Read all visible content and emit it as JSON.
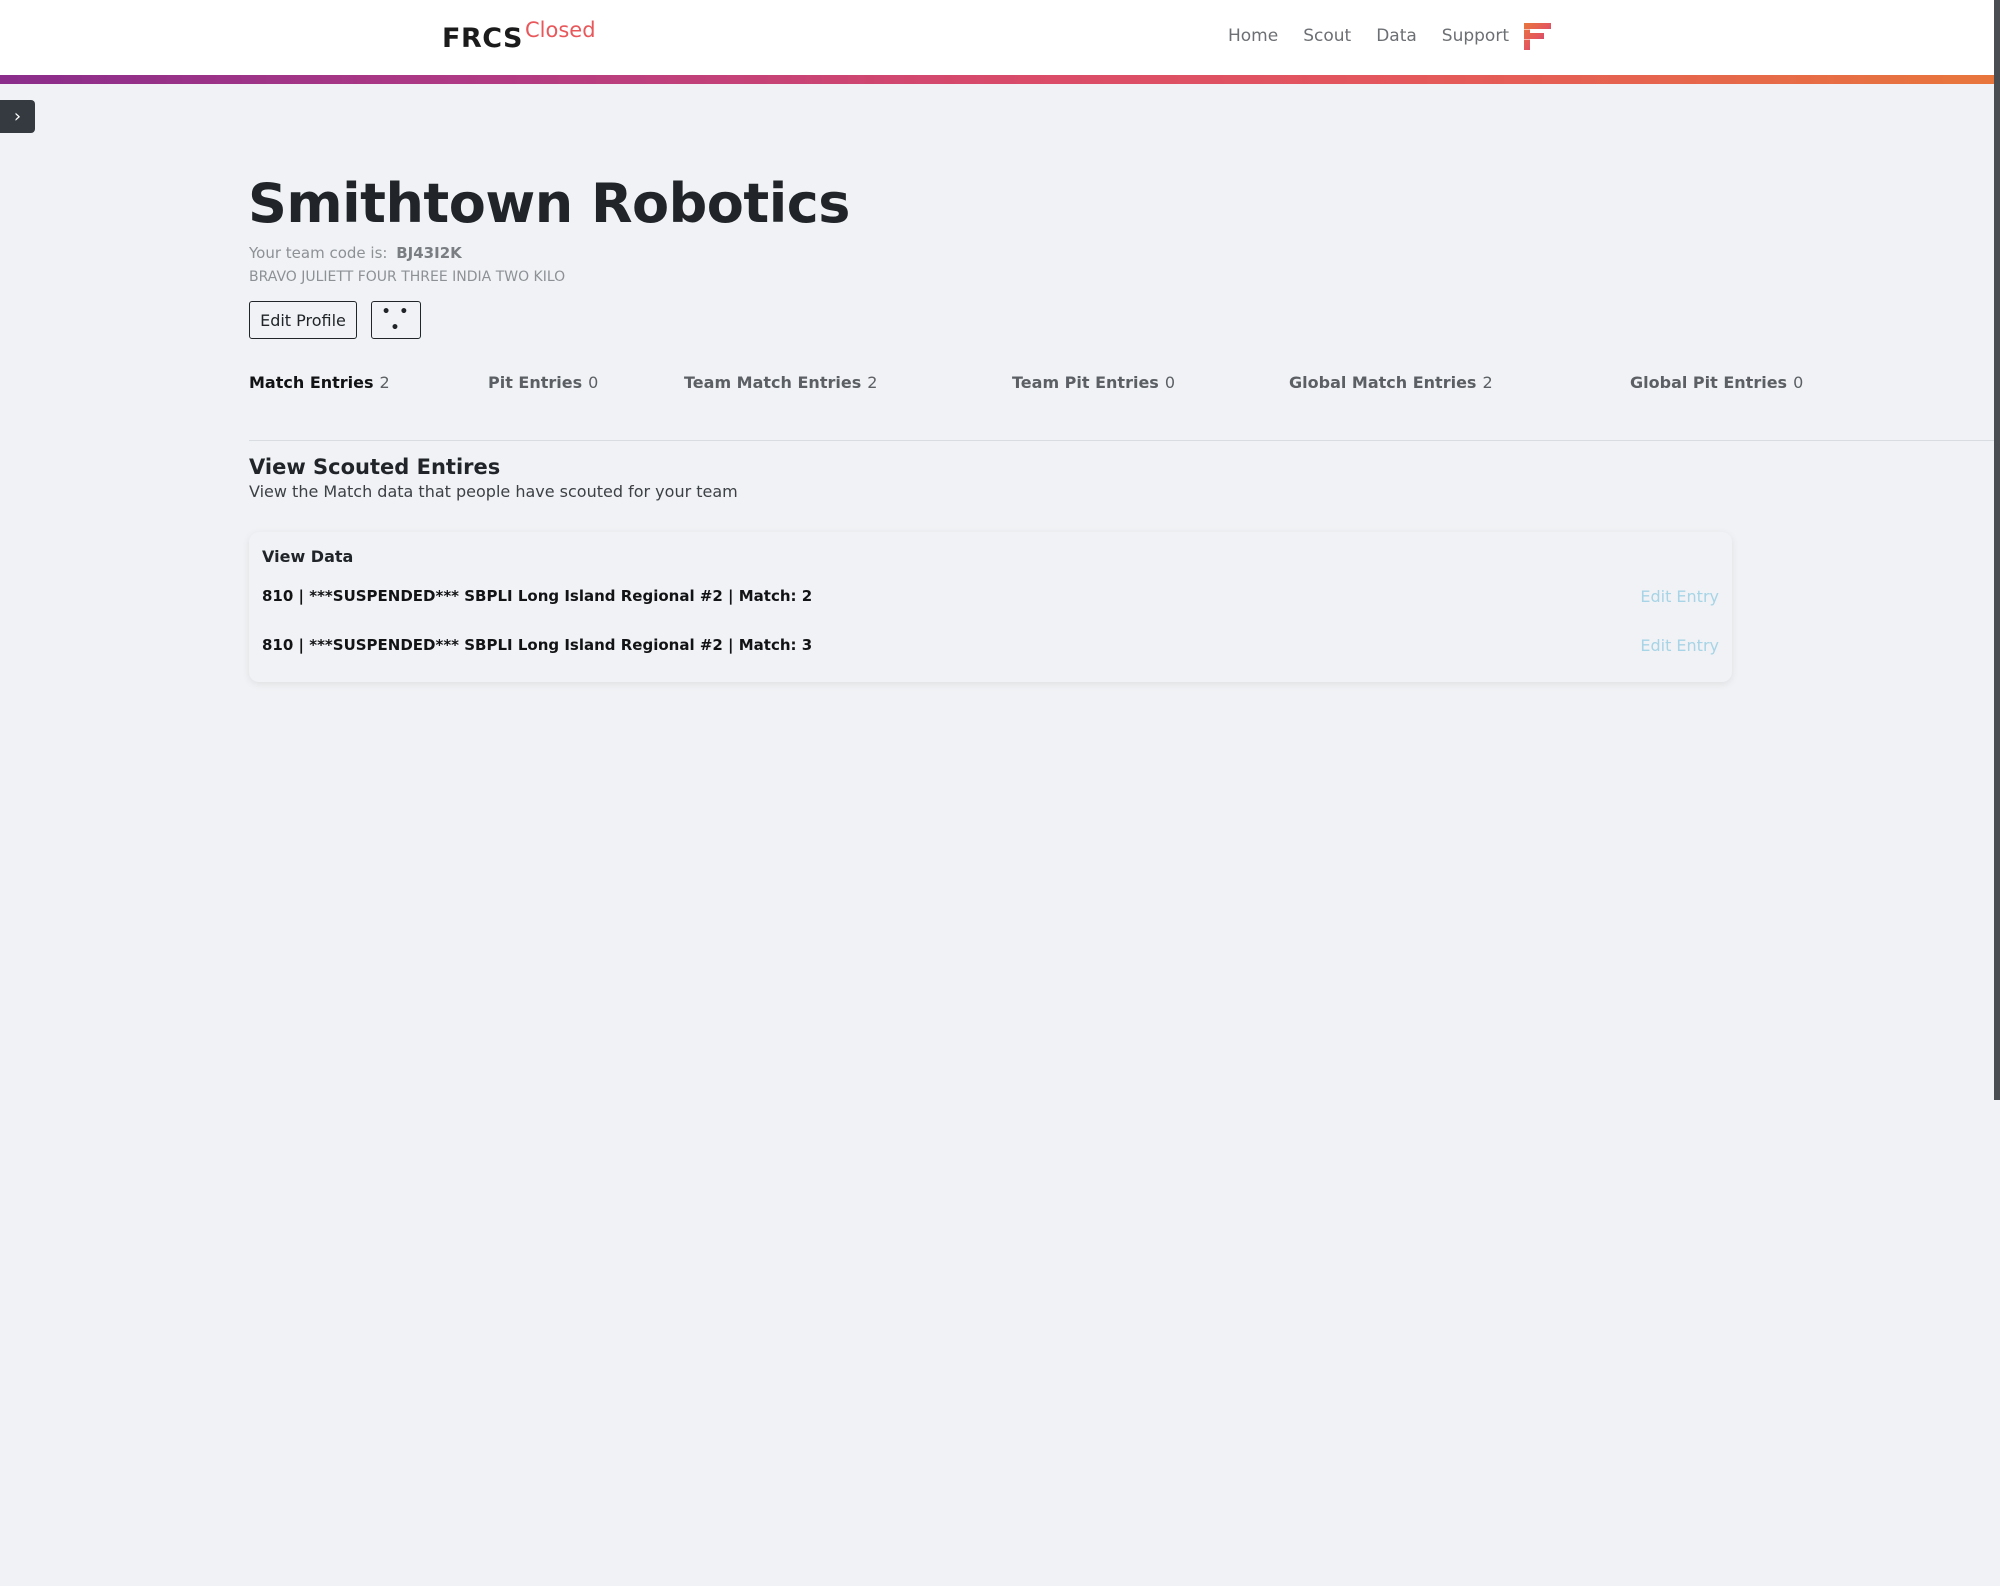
{
  "navbar": {
    "brand": "FRCS",
    "brand_sup": "Closed",
    "links": [
      "Home",
      "Scout",
      "Data",
      "Support"
    ],
    "logo_icon": "frcs-logo-icon"
  },
  "sidebar": {
    "toggle_icon": "chevron-right-icon",
    "toggle_glyph": "›"
  },
  "team": {
    "name": "Smithtown Robotics",
    "code_label": "Your team code is:",
    "code": "BJ43I2K",
    "phonetic": "BRAVO JULIETT FOUR THREE INDIA TWO KILO",
    "edit_profile_label": "Edit Profile",
    "more_label": "• • •"
  },
  "tabs": [
    {
      "label": "Match Entries",
      "count": "2",
      "active": true
    },
    {
      "label": "Pit Entries",
      "count": "0",
      "active": false
    },
    {
      "label": "Team Match Entries",
      "count": "2",
      "active": false
    },
    {
      "label": "Team Pit Entries",
      "count": "0",
      "active": false
    },
    {
      "label": "Global Match Entries",
      "count": "2",
      "active": false
    },
    {
      "label": "Global Pit Entries",
      "count": "0",
      "active": false
    }
  ],
  "section": {
    "title": "View Scouted Entires",
    "subtitle": "View the Match data that people have scouted for your team"
  },
  "card": {
    "header": "View Data",
    "entries": [
      {
        "text": "810 | ***SUSPENDED*** SBPLI Long Island Regional #2 | Match: 2",
        "action": "Edit Entry"
      },
      {
        "text": "810 | ***SUSPENDED*** SBPLI Long Island Regional #2 | Match: 3",
        "action": "Edit Entry"
      }
    ]
  },
  "colors": {
    "accent": "#e8585b",
    "gradient_start": "#8a2d8b",
    "gradient_end": "#e8763c",
    "link_muted": "#a7d4e6"
  }
}
